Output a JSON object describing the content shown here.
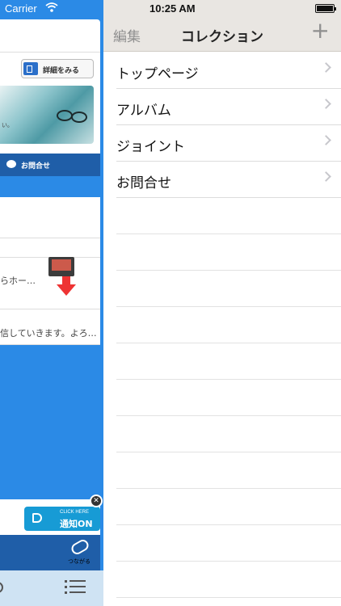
{
  "status": {
    "carrier": "Carrier",
    "time": "10:25 AM"
  },
  "left_app": {
    "detail_button": "詳細をみる",
    "photo_caption": "い。",
    "contact_label": "お問合せ",
    "news_item_1": "らホー…",
    "news_item_2": "信していきます。よろ…",
    "notify": {
      "sub": "CLICK HERE",
      "label": "通知ON"
    },
    "footer_label": "つながる"
  },
  "navbar": {
    "edit": "編集",
    "title": "コレクション",
    "add": "+"
  },
  "collection_items": [
    {
      "label": "トップページ"
    },
    {
      "label": "アルバム"
    },
    {
      "label": "ジョイント"
    },
    {
      "label": "お問合せ"
    }
  ]
}
